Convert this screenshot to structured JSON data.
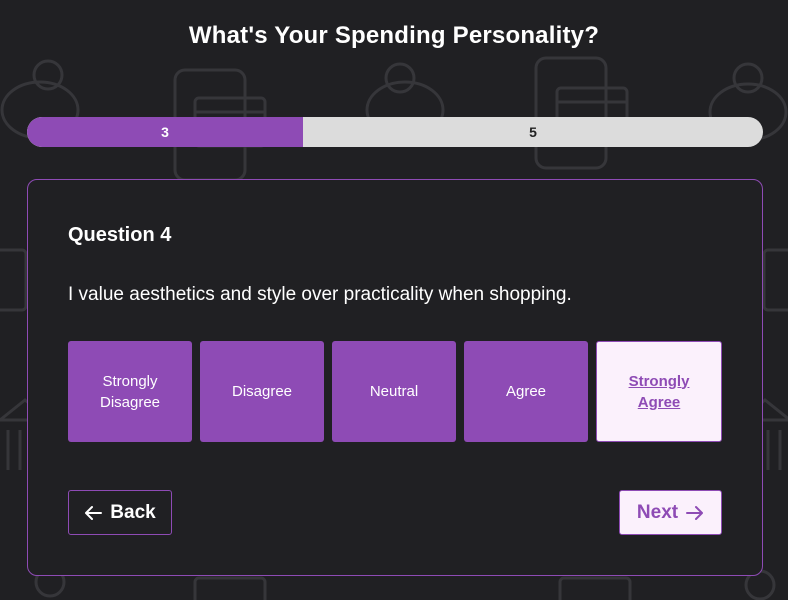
{
  "header": {
    "title": "What's Your Spending Personality?"
  },
  "progress": {
    "current": "3",
    "total": "5",
    "fraction": 0.375
  },
  "question": {
    "heading": "Question 4",
    "text": "I value aesthetics and style over practicality when shopping."
  },
  "options": [
    {
      "label": "Strongly Disagree",
      "selected": false
    },
    {
      "label": "Disagree",
      "selected": false
    },
    {
      "label": "Neutral",
      "selected": false
    },
    {
      "label": "Agree",
      "selected": false
    },
    {
      "label": "Strongly Agree",
      "selected": true
    }
  ],
  "navigation": {
    "back_label": "Back",
    "back_icon": "arrow-left-icon",
    "next_label": "Next",
    "next_icon": "arrow-right-icon"
  },
  "colors": {
    "accent": "#8e4bb5",
    "background": "#202023",
    "selected_background": "#fbf1fc",
    "track": "#dcdcdc"
  }
}
